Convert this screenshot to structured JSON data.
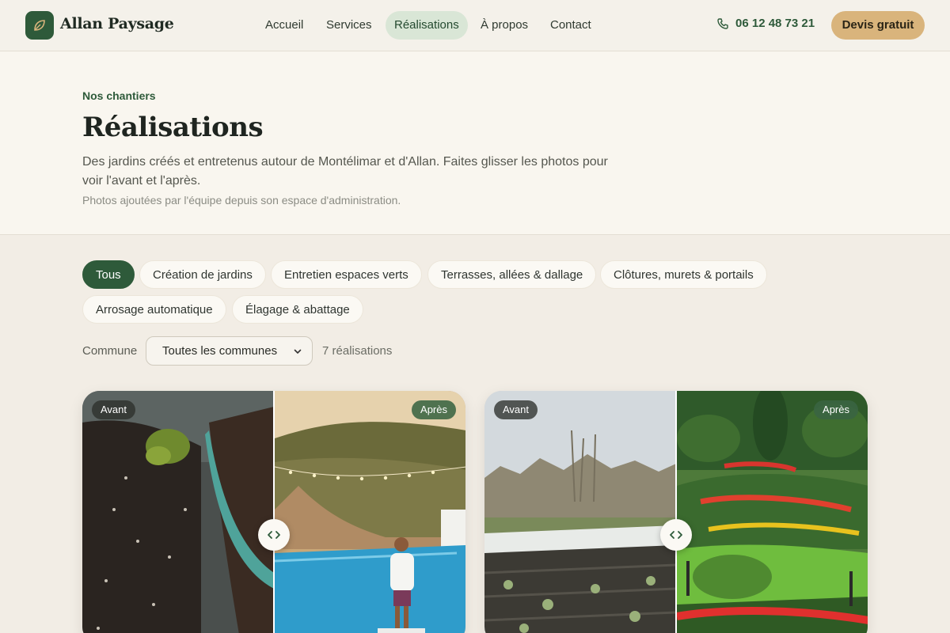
{
  "brand": {
    "name": "Allan Paysage",
    "icon": "leaf-icon"
  },
  "nav": {
    "items": [
      {
        "label": "Accueil",
        "active": false
      },
      {
        "label": "Services",
        "active": false
      },
      {
        "label": "Réalisations",
        "active": true
      },
      {
        "label": "À propos",
        "active": false
      },
      {
        "label": "Contact",
        "active": false
      }
    ],
    "phone": "06 12 48 73 21",
    "phone_icon": "phone-icon",
    "cta": "Devis gratuit"
  },
  "hero": {
    "eyebrow": "Nos chantiers",
    "title": "Réalisations",
    "lead": "Des jardins créés et entretenus autour de Montélimar et d'Allan. Faites glisser les photos pour voir l'avant et l'après.",
    "note": "Photos ajoutées par l'équipe depuis son espace d'administration."
  },
  "filters": {
    "chips": [
      {
        "label": "Tous",
        "active": true
      },
      {
        "label": "Création de jardins",
        "active": false
      },
      {
        "label": "Entretien espaces verts",
        "active": false
      },
      {
        "label": "Terrasses, allées & dallage",
        "active": false
      },
      {
        "label": "Clôtures, murets & portails",
        "active": false
      },
      {
        "label": "Arrosage automatique",
        "active": false
      },
      {
        "label": "Élagage & abattage",
        "active": false
      }
    ],
    "commune_label": "Commune",
    "commune_selected": "Toutes les communes",
    "count": "7 réalisations"
  },
  "cards": [
    {
      "before_label": "Avant",
      "after_label": "Après",
      "slider_position": 0.5,
      "handle_icon": "compare-arrows-icon"
    },
    {
      "before_label": "Avant",
      "after_label": "Après",
      "slider_position": 0.5,
      "handle_icon": "compare-arrows-icon"
    }
  ],
  "colors": {
    "accent": "#2e5a3a",
    "cta": "#d9b47c",
    "background": "#f2ede5"
  }
}
